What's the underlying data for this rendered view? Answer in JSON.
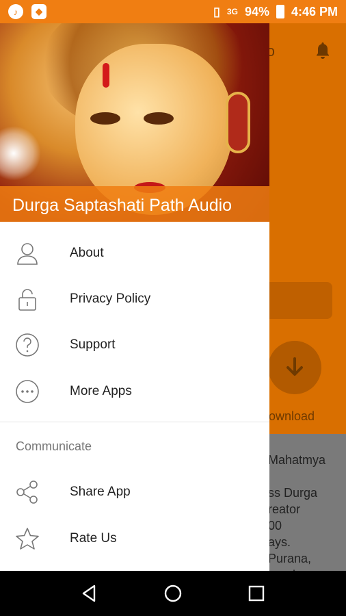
{
  "status_bar": {
    "network": "3G",
    "battery": "94%",
    "time": "4:46 PM"
  },
  "background": {
    "toolbar_title_fragment": "lio",
    "download_label": "Download",
    "text_lines": [
      "Mahatmya",
      "",
      "ss Durga",
      "reator",
      "00",
      "ays.",
      " Purana,",
      "ound"
    ]
  },
  "drawer": {
    "header_title": "Durga Saptashati Path Audio",
    "items": [
      {
        "label": "About",
        "icon": "person-icon"
      },
      {
        "label": "Privacy Policy",
        "icon": "lock-icon"
      },
      {
        "label": "Support",
        "icon": "help-icon"
      },
      {
        "label": "More Apps",
        "icon": "more-icon"
      }
    ],
    "section": "Communicate",
    "communicate_items": [
      {
        "label": "Share App",
        "icon": "share-icon"
      },
      {
        "label": "Rate Us",
        "icon": "star-icon"
      }
    ]
  },
  "colors": {
    "status_bar": "#f07e12",
    "background_dim": "#d96f00",
    "drawer_bg": "#ffffff"
  }
}
